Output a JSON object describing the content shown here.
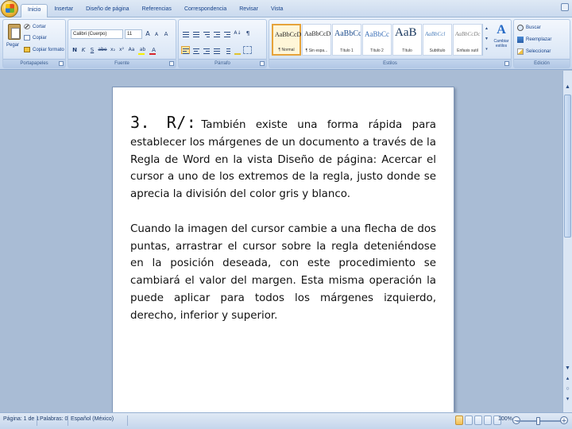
{
  "tabs": [
    "Inicio",
    "Insertar",
    "Diseño de página",
    "Referencias",
    "Correspondencia",
    "Revisar",
    "Vista"
  ],
  "active_tab_index": 0,
  "clipboard": {
    "paste_label": "Pegar",
    "cut_label": "Cortar",
    "copy_label": "Copiar",
    "format_painter_label": "Copiar formato",
    "group_label": "Portapapeles"
  },
  "font": {
    "font_name": "Calibri (Cuerpo)",
    "font_size": "11",
    "group_label": "Fuente",
    "grow": "A",
    "shrink": "A",
    "clear": "A",
    "bold": "N",
    "italic": "K",
    "underline": "S",
    "strike": "abe",
    "subscript": "x₂",
    "superscript": "x²",
    "case": "Aa",
    "highlight": "ab",
    "color": "A",
    "highlight_color": "#f7f000",
    "font_color": "#d8252c"
  },
  "paragraph": {
    "group_label": "Párrafo",
    "pilcrow": "¶",
    "sort": "A↓"
  },
  "styles": {
    "group_label": "Estilos",
    "items": [
      {
        "sample": "AaBbCcDc",
        "name": "¶ Normal",
        "selected": true
      },
      {
        "sample": "AaBbCcDc",
        "name": "¶ Sin espa...",
        "selected": false
      },
      {
        "sample": "AaBbCc",
        "name": "Título 1",
        "selected": false
      },
      {
        "sample": "AaBbCc",
        "name": "Título 2",
        "selected": false
      },
      {
        "sample": "AaB",
        "name": "Título",
        "selected": false
      },
      {
        "sample": "AaBbCcl",
        "name": "Subtítulo",
        "selected": false
      },
      {
        "sample": "AaBbCcDc",
        "name": "Énfasis sutil",
        "selected": false
      }
    ],
    "change_styles_label": "Cambiar estilos",
    "change_styles_glyph": "A",
    "scroll_up": "▲",
    "scroll_down": "▼",
    "more": "▾"
  },
  "editing": {
    "group_label": "Edición",
    "find_label": "Buscar",
    "replace_label": "Reemplazar",
    "select_label": "Seleccionar"
  },
  "document": {
    "answer_label": "3. R/:",
    "paragraph1": "También existe una forma rápida para establecer los márgenes de un documento a través de la Regla de Word en la vista Diseño de página: Acercar el cursor a uno de los extremos de la regla, justo donde se aprecia la división del color gris y blanco.",
    "paragraph2": "Cuando la imagen del cursor cambie a una flecha de dos puntas, arrastrar el cursor sobre la regla deteniéndose en la posición deseada, con este procedimiento se cambiará el valor del margen. Esta misma operación la puede aplicar para todos los márgenes izquierdo, derecho, inferior y superior."
  },
  "statusbar": {
    "pages": "Página: 1 de 1",
    "words": "Palabras: 0",
    "language": "Español (México)",
    "zoom": "100%",
    "zoom_level": 1.0,
    "zoom_minus": "−",
    "zoom_plus": "+"
  },
  "scrollbar": {
    "up": "▲",
    "down": "▼",
    "prev_page": "▴",
    "browse": "○",
    "next_page": "▾"
  }
}
